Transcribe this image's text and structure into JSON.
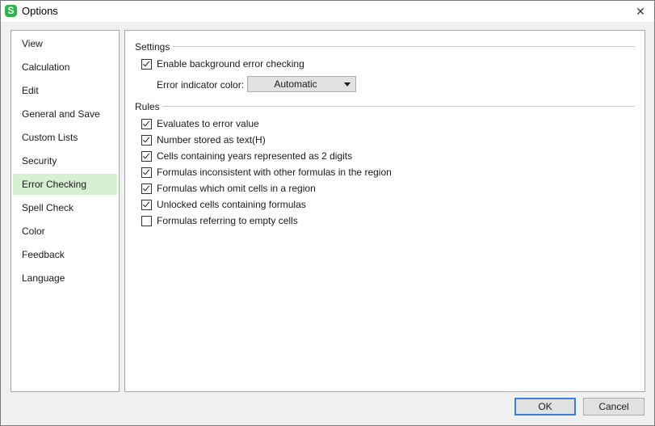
{
  "window": {
    "title": "Options",
    "app_icon_glyph": "S",
    "close_glyph": "✕"
  },
  "sidebar": {
    "selected": "Error Checking",
    "items": [
      {
        "label": "View"
      },
      {
        "label": "Calculation"
      },
      {
        "label": "Edit"
      },
      {
        "label": "General and Save"
      },
      {
        "label": "Custom Lists"
      },
      {
        "label": "Security"
      },
      {
        "label": "Error Checking"
      },
      {
        "label": "Spell Check"
      },
      {
        "label": "Color"
      },
      {
        "label": "Feedback"
      },
      {
        "label": "Language"
      }
    ]
  },
  "settings": {
    "title": "Settings",
    "background_check": {
      "label": "Enable background error checking",
      "checked": true
    },
    "indicator_color": {
      "label": "Error indicator color:",
      "value": "Automatic"
    }
  },
  "rules": {
    "title": "Rules",
    "items": [
      {
        "label": "Evaluates to error value",
        "checked": true
      },
      {
        "label": "Number stored as text(H)",
        "checked": true
      },
      {
        "label": "Cells containing years represented as 2 digits",
        "checked": true
      },
      {
        "label": "Formulas inconsistent with other formulas in the region",
        "checked": true
      },
      {
        "label": "Formulas which omit cells in a region",
        "checked": true
      },
      {
        "label": "Unlocked cells containing formulas",
        "checked": true
      },
      {
        "label": "Formulas referring to empty cells",
        "checked": false
      }
    ]
  },
  "buttons": {
    "ok": "OK",
    "cancel": "Cancel"
  },
  "colors": {
    "selected_bg": "#d6f0d2",
    "brand_green": "#2fb34a",
    "default_button_border": "#3c7fd6"
  }
}
